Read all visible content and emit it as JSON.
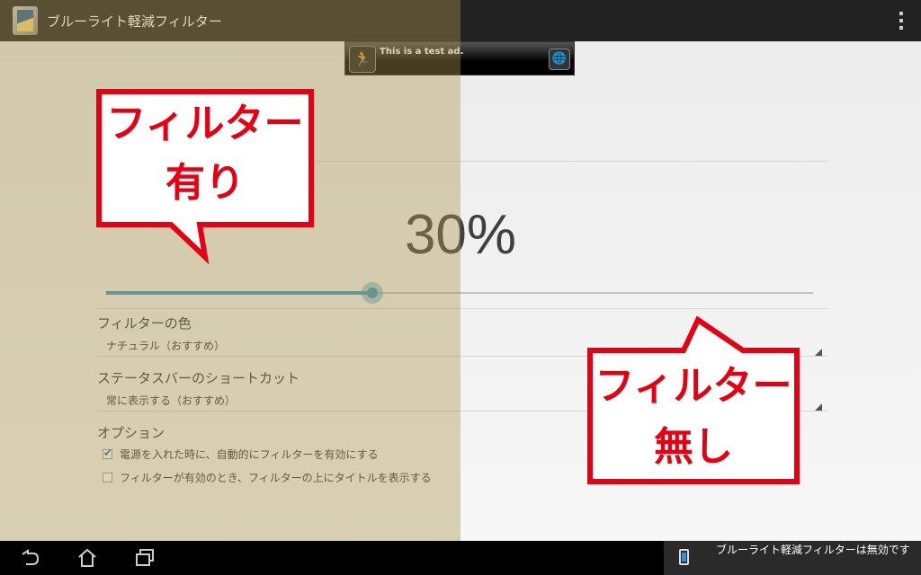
{
  "app": {
    "title": "ブルーライト軽減フィルター",
    "icon": "app-filter-icon"
  },
  "menu": {
    "icon": "overflow-menu-icon"
  },
  "ad": {
    "text": "This is a test ad.",
    "left_icon": "running-person-icon",
    "right_icon": "globe-icon"
  },
  "main": {
    "percentage": "30%",
    "slider_value": 0.377,
    "filter_color": {
      "title": "フィルターの色",
      "value": "ナチュラル（おすすめ）"
    },
    "status_shortcut": {
      "title": "ステータスバーのショートカット",
      "value": "常に表示する（おすすめ）"
    },
    "options": {
      "title": "オプション",
      "items": [
        {
          "label": "電源を入れた時に、自動的にフィルターを有効にする",
          "checked": true
        },
        {
          "label": "フィルターが有効のとき、フィルターの上にタイトルを表示する",
          "checked": false
        }
      ]
    }
  },
  "callouts": {
    "with_filter": {
      "line1": "フィルター",
      "line2": "有り"
    },
    "without_filter": {
      "line1": "フィルター",
      "line2": "無し"
    }
  },
  "notification": {
    "text": "ブルーライト軽減フィルターは無効です"
  },
  "colors": {
    "accent": "#3e95b5",
    "callout_red": "#e60012",
    "filter_tint": "#ac9750"
  }
}
